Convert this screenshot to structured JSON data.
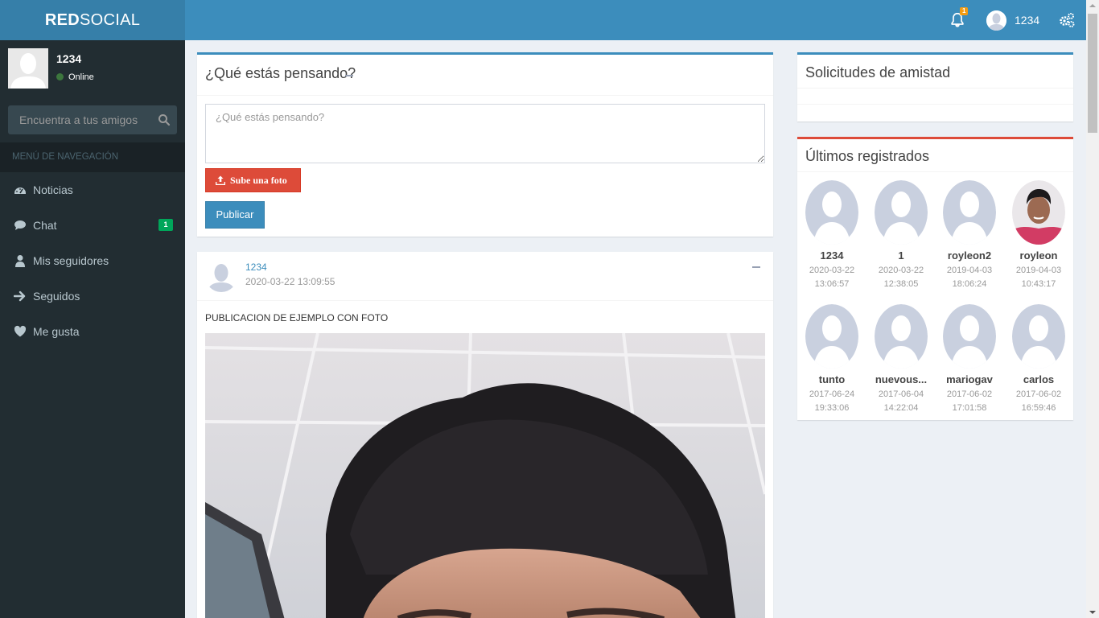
{
  "app": {
    "logo_bold": "RED",
    "logo_light": "SOCIAL"
  },
  "header": {
    "notifications_count": "1",
    "username": "1234",
    "icons": [
      "bell-icon",
      "gears-icon"
    ]
  },
  "sidebar": {
    "user": {
      "name": "1234",
      "status": "Online"
    },
    "search": {
      "placeholder": "Encuentra a tus amigos"
    },
    "nav_header": "MENÚ DE NAVEGACIÓN",
    "items": [
      {
        "label": "Noticias",
        "icon": "dashboard-icon"
      },
      {
        "label": "Chat",
        "icon": "comment-icon",
        "badge": "1"
      },
      {
        "label": "Mis seguidores",
        "icon": "user-icon"
      },
      {
        "label": "Seguidos",
        "icon": "arrow-right-icon"
      },
      {
        "label": "Me gusta",
        "icon": "heart-icon"
      }
    ]
  },
  "composer": {
    "title": "¿Qué estás pensando?",
    "placeholder": "¿Qué estás pensando?",
    "upload_label": "Sube una foto",
    "publish_label": "Publicar"
  },
  "post": {
    "user": "1234",
    "date": "2020-03-22 13:09:55",
    "text": "PUBLICACION DE EJEMPLO CON FOTO"
  },
  "requests": {
    "title": "Solicitudes de amistad"
  },
  "latest": {
    "title": "Últimos registrados",
    "members": [
      {
        "name": "1234",
        "date": "2020-03-22",
        "time": "13:06:57"
      },
      {
        "name": "1",
        "date": "2020-03-22",
        "time": "12:38:05"
      },
      {
        "name": "royleon2",
        "date": "2019-04-03",
        "time": "18:06:24"
      },
      {
        "name": "royleon",
        "date": "2019-04-03",
        "time": "10:43:17"
      },
      {
        "name": "tunto",
        "date": "2017-06-24",
        "time": "19:33:06"
      },
      {
        "name": "nuevous...",
        "date": "2017-06-04",
        "time": "14:22:04"
      },
      {
        "name": "mariogav",
        "date": "2017-06-02",
        "time": "17:01:58"
      },
      {
        "name": "carlos",
        "date": "2017-06-02",
        "time": "16:59:46"
      }
    ]
  },
  "colors": {
    "primary": "#3c8dbc",
    "logo_bg": "#367fa9",
    "sidebar_bg": "#222d32",
    "danger": "#dd4b39",
    "success": "#00a65a",
    "warning": "#f39c12"
  }
}
